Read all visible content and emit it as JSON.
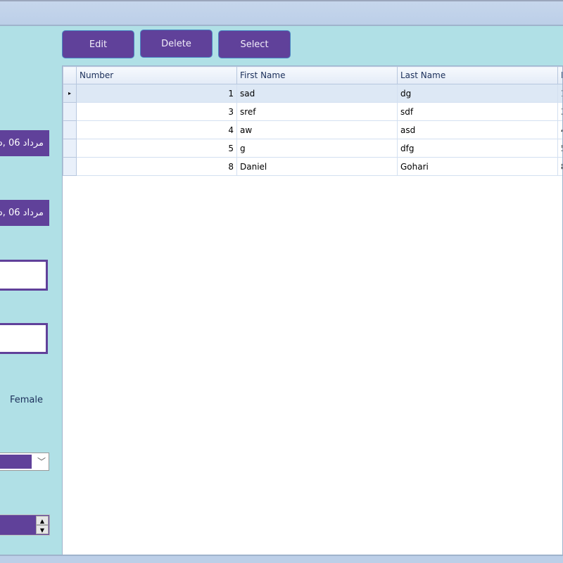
{
  "toolbar": {
    "edit": "Edit",
    "delete": "Delete",
    "select": "Select"
  },
  "form": {
    "date1": "مرداد 06 ,د",
    "date2": "مرداد 06 ,د",
    "female_label": "Female"
  },
  "grid": {
    "columns": [
      "Number",
      "First Name",
      "Last Name",
      "I"
    ],
    "rows": [
      {
        "number": "1",
        "first": "sad",
        "last": "dg",
        "extra": "1"
      },
      {
        "number": "3",
        "first": "sref",
        "last": "sdf",
        "extra": "3"
      },
      {
        "number": "4",
        "first": "aw",
        "last": "asd",
        "extra": "4"
      },
      {
        "number": "5",
        "first": "g",
        "last": "dfg",
        "extra": "5"
      },
      {
        "number": "8",
        "first": "Daniel",
        "last": "Gohari",
        "extra": "8"
      }
    ],
    "current_row_marker": "▸"
  }
}
